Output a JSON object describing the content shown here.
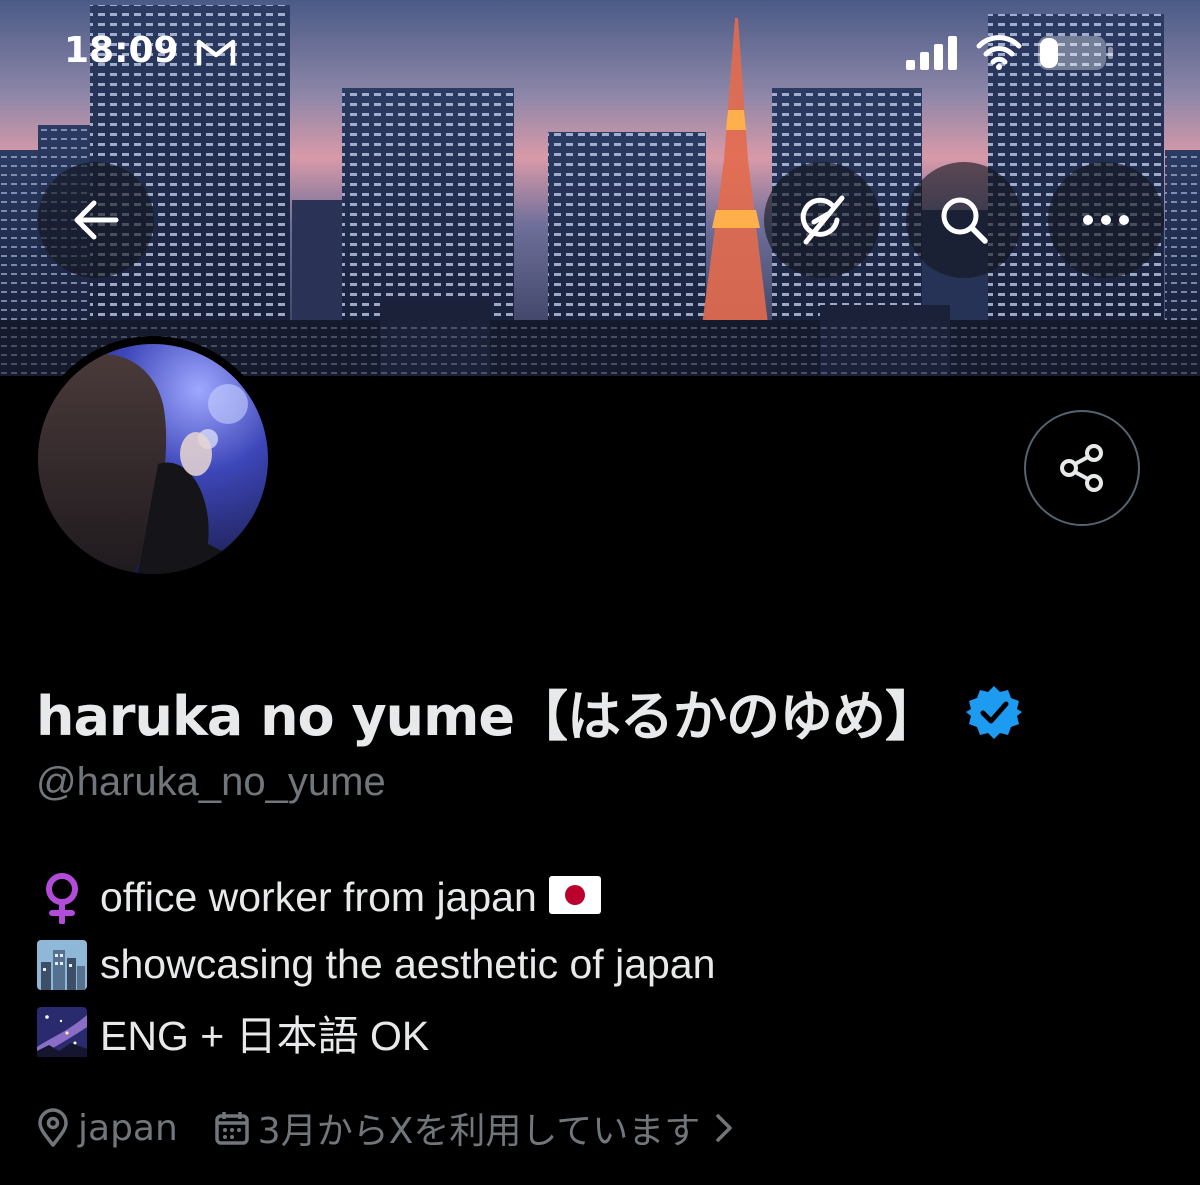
{
  "status_bar": {
    "time": "18:09",
    "icons": [
      "mail-icon",
      "cellular-signal-icon",
      "wifi-icon",
      "battery-icon"
    ]
  },
  "banner": {
    "description_icons": [
      "back-arrow-icon",
      "grok-icon",
      "search-icon",
      "more-icon"
    ]
  },
  "profile": {
    "display_name": "haruka no yume【はるかのゆめ】",
    "verified": true,
    "handle": "@haruka_no_yume",
    "bio": [
      {
        "icon": "female-sign-icon",
        "text": "office worker from japan",
        "trailing_icon": "japan-flag-icon"
      },
      {
        "icon": "cityscape-icon",
        "text": "showcasing the aesthetic of japan"
      },
      {
        "icon": "milky-way-icon",
        "text": "ENG + 日本語 OK"
      }
    ],
    "location": "japan",
    "joined": "3月からXを利用しています"
  },
  "colors": {
    "background": "#000000",
    "primary_text": "#e7e9ea",
    "secondary_text": "#71767b",
    "verified_blue": "#1d9bf0",
    "female_sign": "#b24bd8",
    "flag_red": "#bc002d"
  }
}
